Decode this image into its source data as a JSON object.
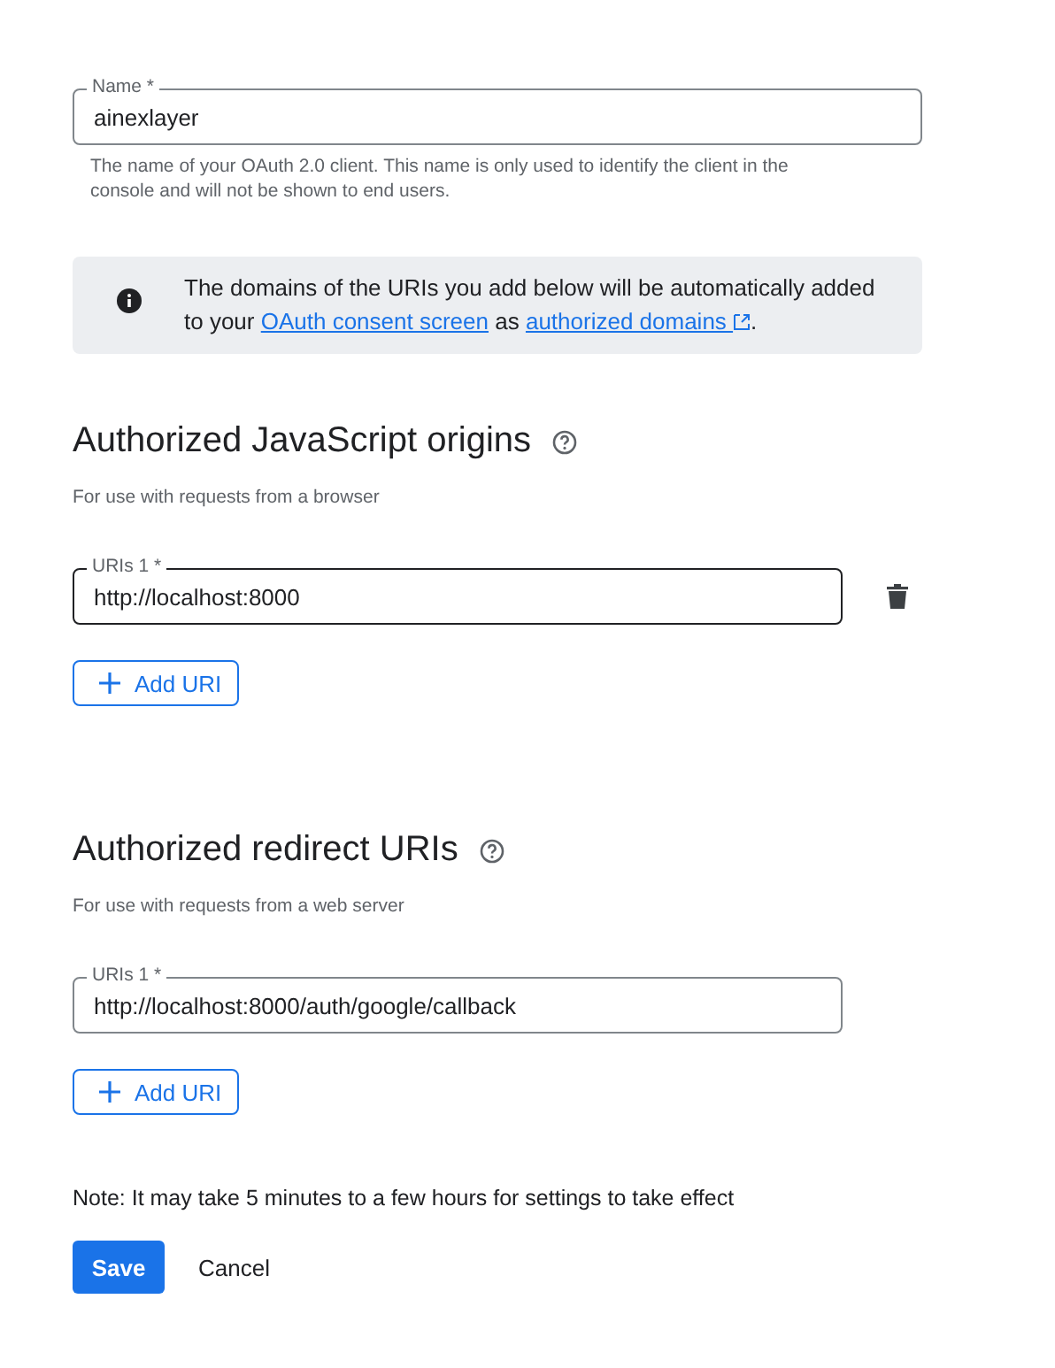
{
  "name_field": {
    "label": "Name *",
    "value": "ainexlayer",
    "focused": false,
    "helper": "The name of your OAuth 2.0 client. This name is only used to identify the client in the console and will not be shown to end users."
  },
  "info": {
    "text_1": "The domains of the URIs you add below will be automatically added to your",
    "link_1": "OAuth consent screen",
    "text_2": "as",
    "link_2": "authorized domains",
    "text_3": "."
  },
  "sections": [
    {
      "title": "Authorized JavaScript origins",
      "subtitle": "For use with requests from a browser",
      "uris": [
        {
          "label": "URIs 1 *",
          "value": "http://localhost:8000",
          "focused": true,
          "deletable": true
        }
      ],
      "add_button": "Add URI"
    },
    {
      "title": "Authorized redirect URIs",
      "subtitle": "For use with requests from a web server",
      "uris": [
        {
          "label": "URIs 1 *",
          "value": "http://localhost:8000/auth/google/callback",
          "focused": false,
          "deletable": false
        }
      ],
      "add_button": "Add URI"
    }
  ],
  "note": "Note: It may take 5 minutes to a few hours for settings to take effect",
  "buttons": {
    "save": "Save",
    "cancel": "Cancel"
  }
}
